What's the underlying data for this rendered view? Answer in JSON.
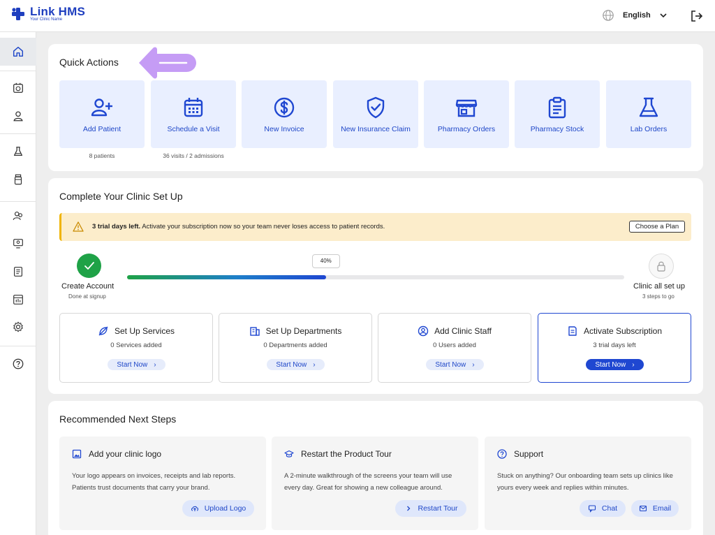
{
  "app": {
    "name": "Link HMS",
    "clinic_name": "Your Clinic Name"
  },
  "header": {
    "language": "English"
  },
  "quick_actions": {
    "title": "Quick Actions",
    "items": [
      {
        "label": "Add Patient",
        "icon": "user-plus-icon",
        "sub": "8 patients"
      },
      {
        "label": "Schedule a Visit",
        "icon": "calendar-icon",
        "sub": "36 visits / 2 admissions"
      },
      {
        "label": "New Invoice",
        "icon": "dollar-circle-icon",
        "sub": ""
      },
      {
        "label": "New Insurance Claim",
        "icon": "shield-check-icon",
        "sub": ""
      },
      {
        "label": "Pharmacy Orders",
        "icon": "store-icon",
        "sub": ""
      },
      {
        "label": "Pharmacy Stock",
        "icon": "clipboard-icon",
        "sub": ""
      },
      {
        "label": "Lab Orders",
        "icon": "flask-icon",
        "sub": ""
      }
    ]
  },
  "setup": {
    "title": "Complete Your Clinic Set Up",
    "banner": {
      "bold": "3 trial days left.",
      "text": " Activate your subscription now so your team never loses access to patient records.",
      "button": "Choose a Plan"
    },
    "progress": {
      "percent": 40,
      "label": "40%"
    },
    "start_step": {
      "label": "Create Account",
      "sub": "Done at signup"
    },
    "end_step": {
      "label": "Clinic all set up",
      "sub": "3 steps to go"
    },
    "tasks": [
      {
        "title": "Set Up Services",
        "icon": "leaf-off-icon",
        "sub": "0 Services added",
        "button": "Start Now"
      },
      {
        "title": "Set Up Departments",
        "icon": "building-icon",
        "sub": "0 Departments added",
        "button": "Start Now"
      },
      {
        "title": "Add Clinic Staff",
        "icon": "user-circle-icon",
        "sub": "0 Users added",
        "button": "Start Now"
      },
      {
        "title": "Activate Subscription",
        "icon": "receipt-icon",
        "sub": "3 trial days left",
        "button": "Start Now"
      }
    ]
  },
  "recommended": {
    "title": "Recommended Next Steps",
    "items": [
      {
        "title": "Add your clinic logo",
        "icon": "image-icon",
        "desc": "Your logo appears on invoices, receipts and lab reports. Patients trust documents that carry your brand.",
        "buttons": [
          "Upload Logo"
        ]
      },
      {
        "title": "Restart the Product Tour",
        "icon": "graduation-cap-icon",
        "desc": "A 2-minute walkthrough of the screens your team will use every day. Great for showing a new colleague around.",
        "buttons": [
          "Restart Tour"
        ]
      },
      {
        "title": "Support",
        "icon": "help-circle-icon",
        "desc": "Stuck on anything? Our onboarding team sets up clinics like yours every week and replies within minutes.",
        "buttons": [
          "Chat",
          "Email"
        ]
      }
    ]
  },
  "colors": {
    "accent": "#1f47d1",
    "tile_bg": "#e9efff",
    "success": "#1fa247",
    "warning_bg": "#fcedcb",
    "annotation": "#c59cf5"
  }
}
